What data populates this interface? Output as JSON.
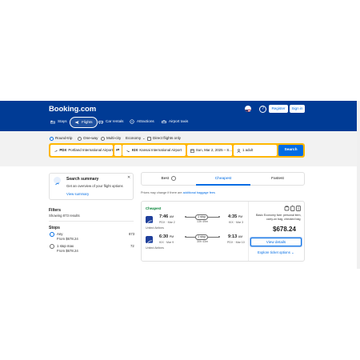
{
  "header": {
    "logo": "Booking.com",
    "register_label": "Register",
    "signin_label": "Sign in",
    "help_label": "?"
  },
  "nav": [
    {
      "label": "Stays",
      "icon": "bed-icon"
    },
    {
      "label": "Flights",
      "icon": "plane-icon"
    },
    {
      "label": "Car rentals",
      "icon": "car-icon"
    },
    {
      "label": "Attractions",
      "icon": "attractions-icon"
    },
    {
      "label": "Airport taxis",
      "icon": "taxi-icon"
    }
  ],
  "search": {
    "trip_types": [
      "Round-trip",
      "One-way",
      "Multi-city"
    ],
    "cabin": "Economy",
    "direct_label": "Direct flights only",
    "from_code": "PDX",
    "from_name": "Portland International Airport",
    "to_code": "KIX",
    "to_name": "Kansai International Airport",
    "dates": "Sun, Mar 2, 2025 – S...",
    "travelers": "1 adult",
    "search_label": "Search"
  },
  "summary": {
    "title": "Search summary",
    "subtitle": "Get an overview of your flight options",
    "link": "View summary",
    "close": "✕"
  },
  "filters": {
    "title": "Filters",
    "showing": "Showing 873 results",
    "stops_title": "Stops",
    "options": [
      {
        "label": "Any",
        "price": "From $678.24",
        "count": "873"
      },
      {
        "label": "1 stop max",
        "price": "From $678.24",
        "count": "72"
      }
    ]
  },
  "tabs": {
    "best": "Best",
    "cheapest": "Cheapest",
    "fastest": "Fastest"
  },
  "price_note": "Prices may change if there are",
  "price_note_link": "additional baggage fees",
  "result": {
    "badge": "Cheapest",
    "airline": "United Airlines",
    "legs": [
      {
        "dep_time": "7:46",
        "dep_ampm": "AM",
        "dep_info": "PDX · Mar 2",
        "stops": "1 stop",
        "duration": "13h 49m",
        "arr_time": "4:35",
        "arr_ampm": "PM",
        "arr_info": "KIX · Mar 3"
      },
      {
        "dep_time": "6:30",
        "dep_ampm": "PM",
        "dep_info": "KIX · Mar 9",
        "stops": "1 stop",
        "duration": "30h 43m",
        "arr_time": "9:13",
        "arr_ampm": "AM",
        "arr_info": "PDX · Mar 10"
      }
    ],
    "baggage_text_1": "Basic Economy fare: personal item,",
    "baggage_text_2": "carry-on bag, checked bag",
    "price": "$678.24",
    "view_details": "View details",
    "explore": "Explore ticket options"
  },
  "colors": {
    "brand_blue": "#003b95",
    "accent_blue": "#006ce4",
    "search_yellow": "#ffb700",
    "cheapest_green": "#008234"
  }
}
